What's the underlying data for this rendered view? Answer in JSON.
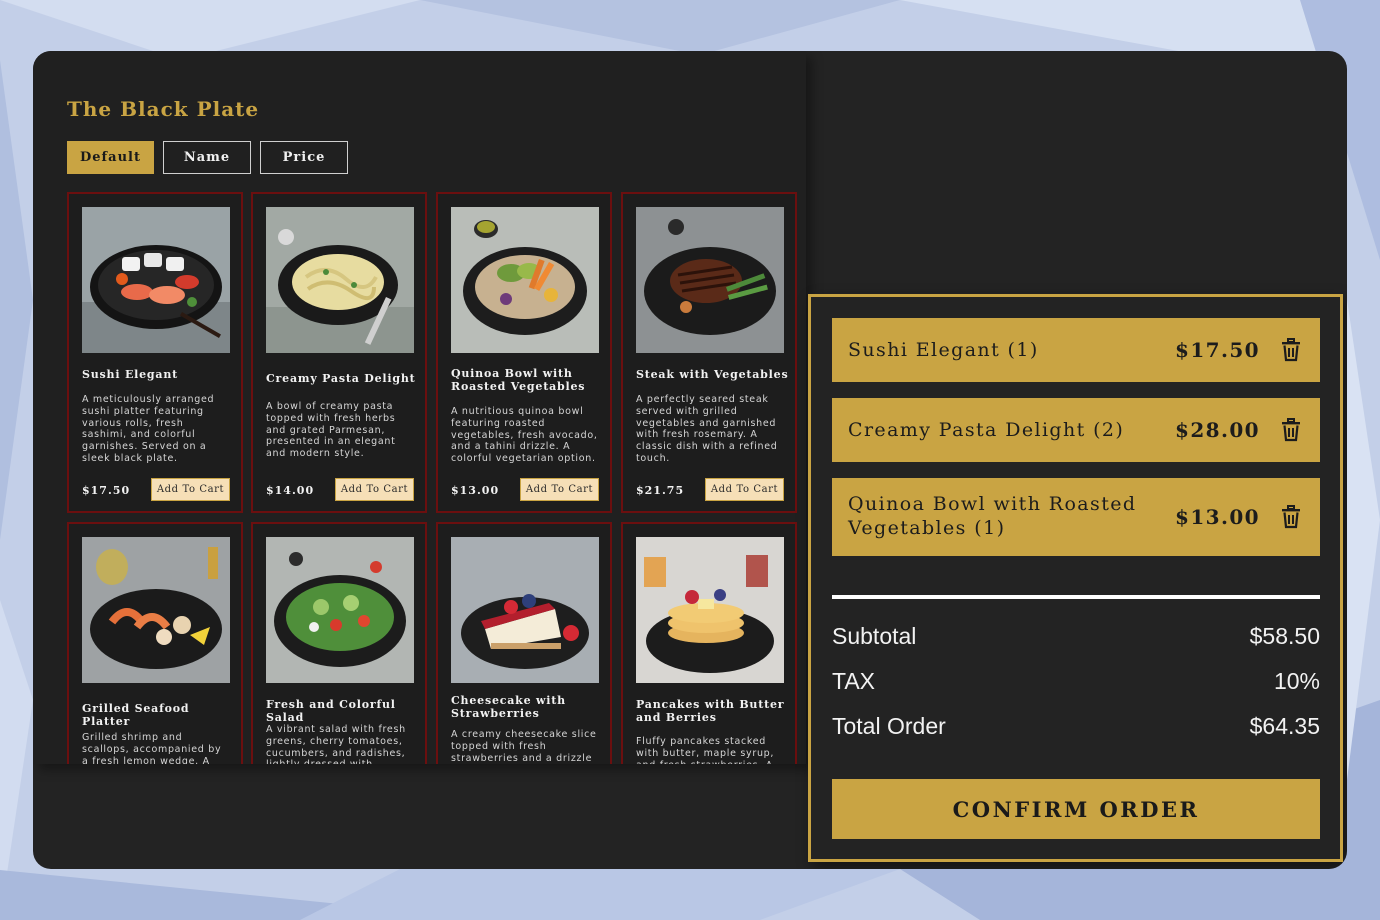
{
  "app": {
    "title": "The Black Plate"
  },
  "sort": {
    "default_label": "Default",
    "name_label": "Name",
    "price_label": "Price",
    "active": "Default"
  },
  "menu": {
    "add_label": "Add To Cart",
    "items": [
      {
        "name": "Sushi Elegant",
        "description": "A meticulously arranged sushi platter featuring various rolls, fresh sashimi, and colorful garnishes. Served on a sleek black plate.",
        "price": "$17.50",
        "image": "sushi-platter-image"
      },
      {
        "name": "Creamy Pasta Delight",
        "description": "A bowl of creamy pasta topped with fresh herbs and grated Parmesan, presented in an elegant and modern style.",
        "price": "$14.00",
        "image": "pasta-bowl-image"
      },
      {
        "name": "Quinoa Bowl with Roasted Vegetables",
        "description": "A nutritious quinoa bowl featuring roasted vegetables, fresh avocado, and a tahini drizzle. A colorful vegetarian option.",
        "price": "$13.00",
        "image": "quinoa-bowl-image"
      },
      {
        "name": "Steak with Vegetables",
        "description": "A perfectly seared steak served with grilled vegetables and garnished with fresh rosemary. A classic dish with a refined touch.",
        "price": "$21.75",
        "image": "steak-plate-image"
      },
      {
        "name": "Grilled Seafood Platter",
        "description": "Grilled shrimp and scallops, accompanied by a fresh lemon wedge. A",
        "price": "",
        "image": "seafood-platter-image"
      },
      {
        "name": "Fresh and Colorful Salad",
        "description": "A vibrant salad with fresh greens, cherry tomatoes, cucumbers, and radishes, lightly dressed with",
        "price": "",
        "image": "salad-bowl-image"
      },
      {
        "name": "Cheesecake with Strawberries",
        "description": "A creamy cheesecake slice topped with fresh strawberries and a drizzle",
        "price": "",
        "image": "cheesecake-image"
      },
      {
        "name": "Pancakes with Butter and Berries",
        "description": "Fluffy pancakes stacked with butter, maple syrup, and fresh strawberries. A",
        "price": "",
        "image": "pancakes-image"
      }
    ]
  },
  "cart": {
    "items": [
      {
        "name": "Sushi Elegant (1)",
        "price": "$17.50"
      },
      {
        "name": "Creamy Pasta Delight (2)",
        "price": "$28.00"
      },
      {
        "name": "Quinoa Bowl with Roasted Vegetables (1)",
        "price": "$13.00"
      }
    ],
    "subtotal_label": "Subtotal",
    "subtotal": "$58.50",
    "tax_label": "TAX",
    "tax": "10%",
    "total_label": "Total Order",
    "total": "$64.35",
    "confirm_label": "CONFIRM ORDER"
  },
  "colors": {
    "accent": "#c9a443",
    "panel": "#202020",
    "card_border": "#6b0f0f",
    "add_button": "#f6dfb7"
  }
}
